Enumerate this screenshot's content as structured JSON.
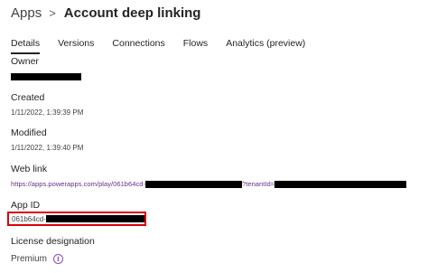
{
  "breadcrumb": {
    "root": "Apps",
    "separator": ">",
    "title": "Account deep linking"
  },
  "tabs": [
    {
      "label": "Details",
      "active": true
    },
    {
      "label": "Versions"
    },
    {
      "label": "Connections"
    },
    {
      "label": "Flows"
    },
    {
      "label": "Analytics (preview)"
    }
  ],
  "details": {
    "owner_label": "Owner",
    "created_label": "Created",
    "created_value": "1/11/2022, 1:39:39 PM",
    "modified_label": "Modified",
    "modified_value": "1/11/2022, 1:39:40 PM",
    "weblink_label": "Web link",
    "weblink_prefix": "https://apps.powerapps.com/play/061b64cd-",
    "weblink_mid": "?tenantId=",
    "appid_label": "App ID",
    "appid_prefix": "061b64cd-",
    "license_label": "License designation",
    "license_value": "Premium"
  },
  "colors": {
    "link": "#6b2e8c",
    "highlight_border": "#d9000d",
    "redaction": "#000000"
  },
  "icons": {
    "breadcrumb_separator": "chevron-right-icon",
    "license_info": "info-icon"
  }
}
